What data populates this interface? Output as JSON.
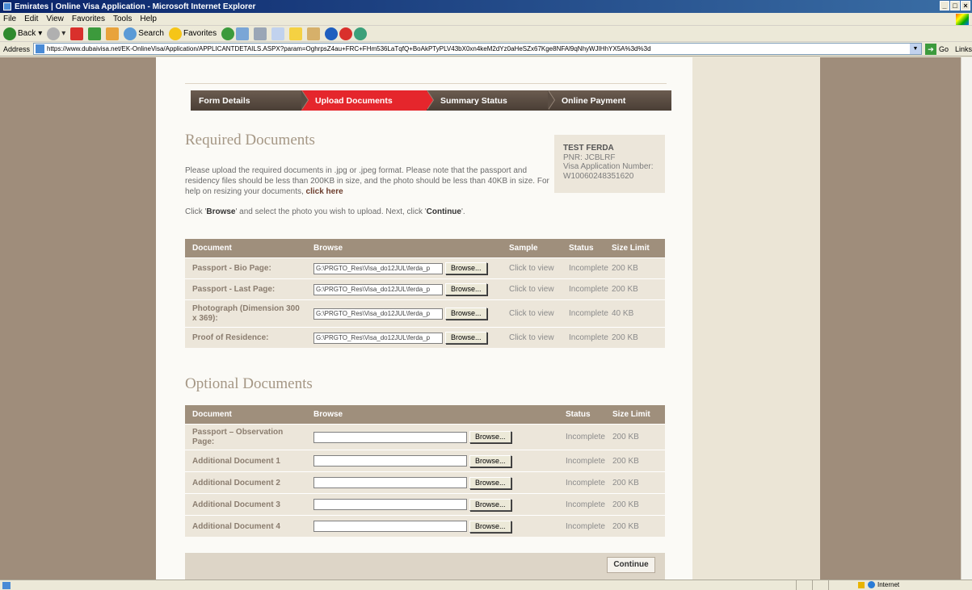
{
  "browser": {
    "title": "Emirates | Online Visa Application - Microsoft Internet Explorer",
    "menu": [
      "File",
      "Edit",
      "View",
      "Favorites",
      "Tools",
      "Help"
    ],
    "toolbar": {
      "back": "Back",
      "search": "Search",
      "favorites": "Favorites"
    },
    "address_label": "Address",
    "url": "https://www.dubaivisa.net/EK-OnlineVisa/Application/APPLICANTDETAILS.ASPX?param=OghrpsZ4au+FRC+FHm536LaTqfQ+BoAkPTyPLV43bX0xn4keM2dYz0aHeSZx67Kge8NFAl9qNhyWJIHhYX5A%3d%3d",
    "go": "Go",
    "links": "Links",
    "status_zone": "Internet"
  },
  "steps": [
    "Form Details",
    "Upload Documents",
    "Summary Status",
    "Online Payment"
  ],
  "required": {
    "heading": "Required Documents",
    "intro": "Please upload the required documents in .jpg or .jpeg format. Please note that the passport and residency files should be less than 200KB in size, and the photo should be less than 40KB in size. For help on resizing your documents,",
    "help_link": "click here",
    "instr_pre": "Click '",
    "instr_browse": "Browse",
    "instr_mid": "' and select the photo you wish to upload. Next, click '",
    "instr_continue": "Continue",
    "instr_post": "'.",
    "columns": [
      "Document",
      "Browse",
      "Sample",
      "Status",
      "Size Limit"
    ],
    "rows": [
      {
        "doc": "Passport - Bio Page:",
        "file": "G:\\PRGTO_Res\\Visa_do12JUL\\ferda_p",
        "browse": "Browse...",
        "sample": "Click to view",
        "status": "Incomplete",
        "size": "200 KB"
      },
      {
        "doc": "Passport - Last Page:",
        "file": "G:\\PRGTO_Res\\Visa_do12JUL\\ferda_p",
        "browse": "Browse...",
        "sample": "Click to view",
        "status": "Incomplete",
        "size": "200 KB"
      },
      {
        "doc": "Photograph (Dimension 300 x 369):",
        "file": "G:\\PRGTO_Res\\Visa_do12JUL\\ferda_p",
        "browse": "Browse...",
        "sample": "Click to view",
        "status": "Incomplete",
        "size": "40 KB"
      },
      {
        "doc": "Proof of Residence:",
        "file": "G:\\PRGTO_Res\\Visa_do12JUL\\ferda_p",
        "browse": "Browse...",
        "sample": "Click to view",
        "status": "Incomplete",
        "size": "200 KB"
      }
    ]
  },
  "applicant": {
    "name": "TEST FERDA",
    "pnr": "PNR: JCBLRF",
    "visa_label": "Visa Application Number:",
    "visa_number": "W10060248351620"
  },
  "optional": {
    "heading": "Optional Documents",
    "columns": [
      "Document",
      "Browse",
      "Status",
      "Size Limit"
    ],
    "rows": [
      {
        "doc": "Passport – Observation Page:",
        "browse": "Browse...",
        "status": "Incomplete",
        "size": "200 KB"
      },
      {
        "doc": "Additional Document 1",
        "browse": "Browse...",
        "status": "Incomplete",
        "size": "200 KB"
      },
      {
        "doc": "Additional Document 2",
        "browse": "Browse...",
        "status": "Incomplete",
        "size": "200 KB"
      },
      {
        "doc": "Additional Document 3",
        "browse": "Browse...",
        "status": "Incomplete",
        "size": "200 KB"
      },
      {
        "doc": "Additional Document 4",
        "browse": "Browse...",
        "status": "Incomplete",
        "size": "200 KB"
      }
    ]
  },
  "continue_label": "Continue"
}
